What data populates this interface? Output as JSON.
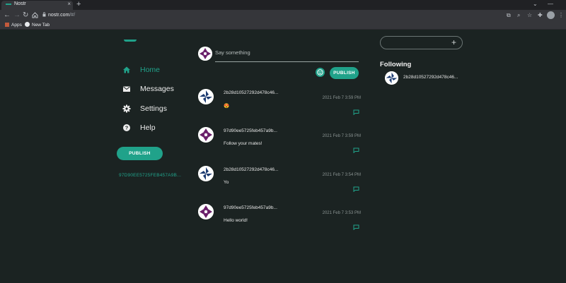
{
  "browser": {
    "tab_title": "Nostr",
    "tab_close": "×",
    "new_tab": "+",
    "url_host": "nostr.com",
    "url_path": "/#/",
    "bookmarks": [
      "Apps",
      "New Tab"
    ],
    "window_controls": [
      "⌄",
      "—"
    ],
    "icons": [
      "back-icon",
      "forward-icon",
      "reload-icon",
      "home-icon",
      "lock-icon",
      "share-icon",
      "zoom-icon",
      "star-icon",
      "extensions-icon",
      "profile-icon",
      "menu-icon"
    ]
  },
  "sidebar": {
    "items": [
      {
        "label": "Home",
        "icon": "home-icon",
        "active": true
      },
      {
        "label": "Messages",
        "icon": "mail-icon",
        "active": false
      },
      {
        "label": "Settings",
        "icon": "gear-icon",
        "active": false
      },
      {
        "label": "Help",
        "icon": "help-icon",
        "active": false
      }
    ],
    "publish_label": "PUBLISH",
    "pubkey": "97D90EE5725FEB457A9B..."
  },
  "composer": {
    "placeholder": "Say something",
    "publish_label": "PUBLISH",
    "emoji_icon": "smile-icon"
  },
  "feed": [
    {
      "author": "2b28d10527292d478c46...",
      "time": "2021 Feb 7 3:59 PM",
      "content": "😍",
      "avatar": "blue"
    },
    {
      "author": "97d90ee5725feb457a9b...",
      "time": "2021 Feb 7 3:59 PM",
      "content": "Follow your mates!",
      "avatar": "purple"
    },
    {
      "author": "2b28d10527292d478c46...",
      "time": "2021 Feb 7 3:54 PM",
      "content": "Yo",
      "avatar": "blue"
    },
    {
      "author": "97d90ee5725feb457a9b...",
      "time": "2021 Feb 7 3:53 PM",
      "content": "Hello world!",
      "avatar": "purple"
    }
  ],
  "right": {
    "search_icon": "plus-icon",
    "search_plus": "+",
    "following_title": "Following",
    "following": [
      {
        "pubkey": "2b28d10527292d478c46...",
        "avatar": "blue"
      }
    ]
  },
  "colors": {
    "background": "#1b2322",
    "accent": "#20a28a",
    "avatar_blue": "#1e3c72",
    "avatar_purple": "#6a1f6a"
  }
}
